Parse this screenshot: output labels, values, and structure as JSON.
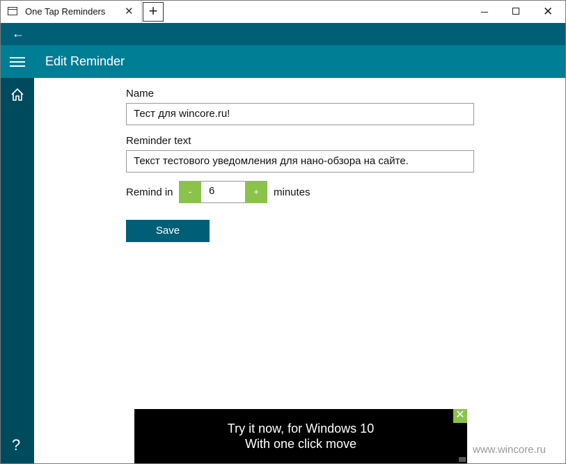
{
  "window": {
    "tab_title": "One Tap Reminders",
    "tab_close_glyph": "✕",
    "newtab_glyph": "+",
    "close_glyph": "✕"
  },
  "nav": {
    "back_glyph": "←",
    "header_title": "Edit Reminder",
    "help_glyph": "?"
  },
  "form": {
    "name_label": "Name",
    "name_value": "Тест для wincore.ru!",
    "text_label": "Reminder text",
    "text_value": "Текст тестового уведомления для нано-обзора на сайте.",
    "remind_label": "Remind in",
    "minus_label": "-",
    "remind_value": "6",
    "plus_label": "+",
    "unit_label": "minutes",
    "save_label": "Save"
  },
  "ad": {
    "line1": "Try it now, for Windows 10",
    "line2": "With one click move",
    "close_glyph": "✕"
  },
  "watermark": "www.wincore.ru",
  "colors": {
    "backbar": "#005f76",
    "header": "#007e96",
    "sidebar": "#004a5e",
    "accent_green": "#8bc34a",
    "save_button": "#005f76"
  },
  "icons": [
    "window-icon",
    "back-arrow-icon",
    "hamburger-icon",
    "home-icon",
    "help-icon",
    "close-icon"
  ]
}
